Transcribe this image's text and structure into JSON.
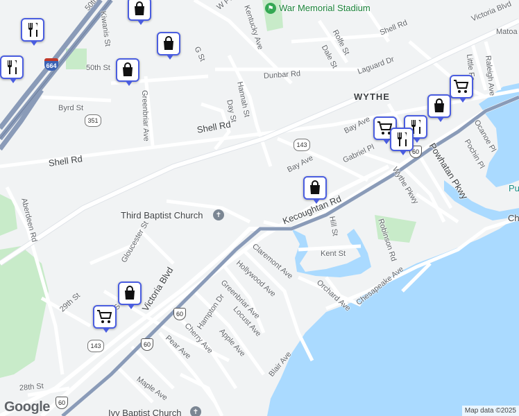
{
  "map": {
    "labels": {
      "w_pembroke": "W Pe",
      "kentucky_ave": "Kentucky Ave",
      "war_memorial": "War Memorial Stadium",
      "victoria_blvd_top": "Victoria Blvd",
      "shell_rd_top": "Shell Rd",
      "matoaka": "Matoa",
      "rolfe_st": "Rolfe St",
      "dale_st": "Dale St",
      "fiftieth_st_top": "50th St",
      "kiwanis_st": "Kiwanis St",
      "g_st": "G St",
      "little_farms": "Little Fa",
      "raleigh_ave": "Raleigh Ave",
      "fiftieth_st": "50th St",
      "dunbar_rd": "Dunbar Rd",
      "laguard_dr": "Laguard Dr",
      "hannah_st": "Hannah St",
      "day_st": "Day St",
      "greenbriar_ave_n": "Greenbriar Ave",
      "byrd_st": "Byrd St",
      "wythe": "WYTHE",
      "ocanoe_pl": "Ocanoe Pl",
      "shell_rd_mid": "Shell Rd",
      "bay_ave_n": "Bay Ave",
      "pochin_pl": "Pochin Pl",
      "powhatan_pkwy": "Powhatan Pkwy",
      "shell_rd_w": "Shell Rd",
      "gabriel_pl": "Gabriel Pl",
      "bay_ave": "Bay Ave",
      "wythe_pkwy": "Wythe Pkwy",
      "pu": "Pu",
      "aberdeen_rd": "Aberdeen Rd",
      "third_baptist": "Third Baptist Church",
      "kecoughtan_rd": "Kecoughtan Rd",
      "hill_st": "Hill St",
      "robinson_rd": "Robinson Rd",
      "ch": "Ch",
      "gloucester_st": "Gloucester St",
      "claremont_ave": "Claremont Ave",
      "kent_st": "Kent St",
      "victoria_blvd": "Victoria Blvd",
      "hollywood_ave": "Hollywood Ave",
      "chesapeake_ave": "Chesapeake Ave",
      "orchard_ave": "Orchard Ave",
      "greenbriar_ave_s": "Greenbriar Ave",
      "twentyninth_st": "29th St",
      "th_s": "th S",
      "hampton_dr": "Hampton Dr",
      "locust_ave": "Locust Ave",
      "apple_ave": "Apple Ave",
      "cherry_ave": "Cherry Ave",
      "pear_ave": "Pear Ave",
      "blair_ave": "Blair Ave",
      "maple_ave": "Maple Ave",
      "twentyeighth_st": "28th St",
      "ivy_baptist": "Ivy Baptist Church"
    },
    "route_shields": {
      "i664": "664",
      "r351": "351",
      "r143_n": "143",
      "r143_s": "143",
      "us60_a": "60",
      "us60_b": "60",
      "us60_c": "60",
      "us60_d": "60"
    },
    "pins": [
      {
        "type": "shopping-bag",
        "icon": "shopping-bag-icon"
      },
      {
        "type": "restaurant",
        "icon": "restaurant-icon"
      },
      {
        "type": "shopping-bag",
        "icon": "shopping-bag-icon"
      },
      {
        "type": "restaurant",
        "icon": "restaurant-icon"
      },
      {
        "type": "shopping-bag",
        "icon": "shopping-bag-icon"
      },
      {
        "type": "shopping-cart",
        "icon": "shopping-cart-icon"
      },
      {
        "type": "shopping-bag",
        "icon": "shopping-bag-icon"
      },
      {
        "type": "restaurant",
        "icon": "restaurant-icon"
      },
      {
        "type": "shopping-cart",
        "icon": "shopping-cart-icon"
      },
      {
        "type": "restaurant",
        "icon": "restaurant-icon"
      },
      {
        "type": "shopping-bag",
        "icon": "shopping-bag-icon"
      },
      {
        "type": "shopping-bag",
        "icon": "shopping-bag-icon"
      },
      {
        "type": "shopping-cart",
        "icon": "shopping-cart-icon"
      }
    ],
    "colors": {
      "water": "#aadaff",
      "park": "#c8ebc9",
      "road": "#ffffff",
      "highway": "#8c9bb5",
      "pin_border": "#4a5de0"
    }
  },
  "footer": {
    "logo": "Google",
    "attribution": "Map data ©2025"
  }
}
